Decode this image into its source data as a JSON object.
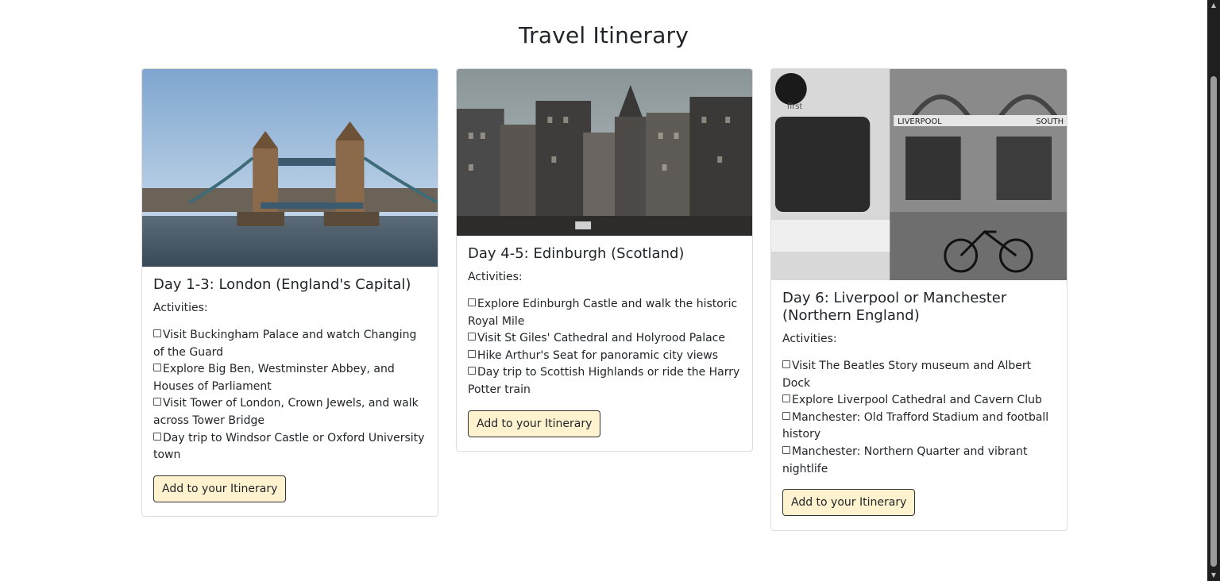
{
  "page": {
    "title": "Travel Itinerary"
  },
  "cards": [
    {
      "title": "Day 1-3: London (England's Capital)",
      "activities_label": "Activities:",
      "activities": [
        "Visit Buckingham Palace and watch Changing of the Guard",
        "Explore Big Ben, Westminster Abbey, and Houses of Parliament",
        "Visit Tower of London, Crown Jewels, and walk across Tower Bridge",
        "Day trip to Windsor Castle or Oxford University town"
      ],
      "button": "Add to your Itinerary",
      "image": "tower-bridge-photo"
    },
    {
      "title": "Day 4-5: Edinburgh (Scotland)",
      "activities_label": "Activities:",
      "activities": [
        "Explore Edinburgh Castle and walk the historic Royal Mile",
        "Visit St Giles' Cathedral and Holyrood Palace",
        "Hike Arthur's Seat for panoramic city views",
        "Day trip to Scottish Highlands or ride the Harry Potter train"
      ],
      "button": "Add to your Itinerary",
      "image": "edinburgh-old-town-photo"
    },
    {
      "title": "Day 6: Liverpool or Manchester (Northern England)",
      "activities_label": "Activities:",
      "activities": [
        "Visit The Beatles Story museum and Albert Dock",
        "Explore Liverpool Cathedral and Cavern Club",
        "Manchester: Old Trafford Stadium and football history",
        "Manchester: Northern Quarter and vibrant nightlife"
      ],
      "button": "Add to your Itinerary",
      "image": "liverpool-street-bw-photo",
      "image_sign_text": [
        "LIVERPOOL",
        "SOUTH",
        "first"
      ]
    }
  ],
  "colors": {
    "button_bg": "#fff3cf",
    "card_border": "#dcdcdc",
    "text": "#212529"
  },
  "icons": {
    "checkbox": "checkbox-icon",
    "scroll_up": "scroll-up-arrow-icon",
    "scroll_down": "scroll-down-arrow-icon"
  }
}
